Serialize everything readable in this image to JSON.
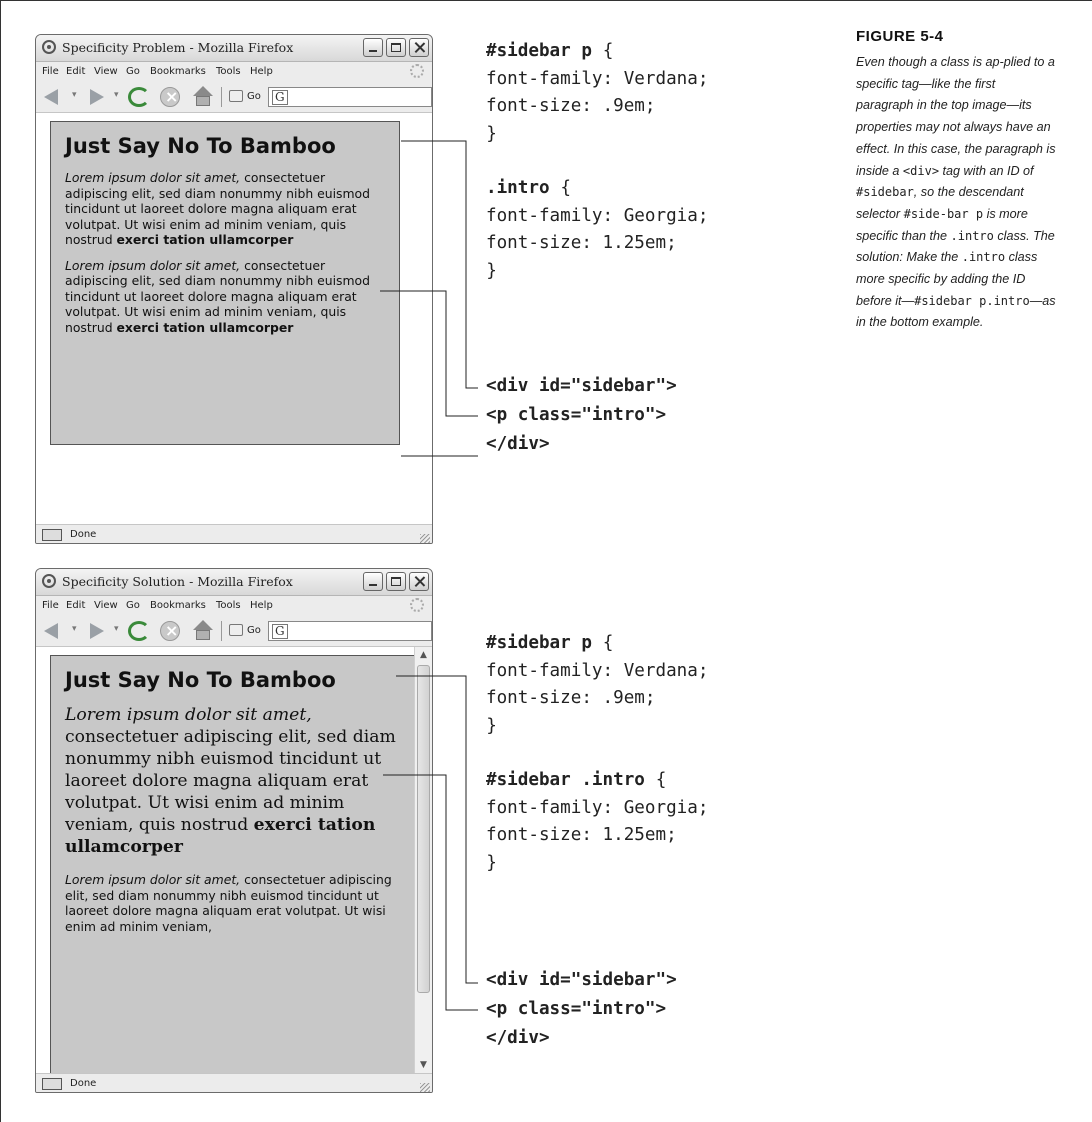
{
  "figure": {
    "label": "FIGURE 5-4",
    "caption": [
      {
        "t": "Even though a class is ap-plied to a specific tag—like the first paragraph in the top image—its properties may not always have an effect. In this case, the paragraph is inside a ",
        "m": false
      },
      {
        "t": "<div>",
        "m": true
      },
      {
        "t": " tag with an ID of ",
        "m": false
      },
      {
        "t": "#sidebar",
        "m": true
      },
      {
        "t": ", so the descendant selector ",
        "m": false
      },
      {
        "t": "#side-bar p",
        "m": true
      },
      {
        "t": " is more specific than the ",
        "m": false
      },
      {
        "t": ".intro",
        "m": true
      },
      {
        "t": " class. The solution: Make the ",
        "m": false
      },
      {
        "t": ".intro",
        "m": true
      },
      {
        "t": " class more specific by adding the ID before it—",
        "m": false
      },
      {
        "t": "#sidebar p.intro",
        "m": true
      },
      {
        "t": "—as in the bottom example.",
        "m": false
      }
    ]
  },
  "browser_top": {
    "title": "Specificity Problem - Mozilla Firefox",
    "menu": [
      "File",
      "Edit",
      "View",
      "Go",
      "Bookmarks",
      "Tools",
      "Help"
    ],
    "go_label": "Go",
    "url_icon_label": "G",
    "status": "Done",
    "heading": "Just Say No To Bamboo",
    "p1_italic": "Lorem ipsum dolor sit amet,",
    "p1_text": " consectetuer adipiscing elit, sed diam nonummy nibh euismod tincidunt ut laoreet dolore magna aliquam erat volutpat. Ut wisi enim ad minim veniam, quis nostrud ",
    "p1_bold": "exerci tation ullamcorper",
    "p2_italic": "Lorem ipsum dolor sit amet,",
    "p2_text": " consectetuer adipiscing elit, sed diam nonummy nibh euismod tincidunt ut laoreet dolore magna aliquam erat volutpat. Ut wisi enim ad minim veniam, quis nostrud ",
    "p2_bold": "exerci tation ullamcorper"
  },
  "browser_bottom": {
    "title": "Specificity Solution - Mozilla Firefox",
    "menu": [
      "File",
      "Edit",
      "View",
      "Go",
      "Bookmarks",
      "Tools",
      "Help"
    ],
    "go_label": "Go",
    "url_icon_label": "G",
    "status": "Done",
    "heading": "Just Say No To Bamboo",
    "p1_italic": "Lorem ipsum dolor sit amet,",
    "p1_text": " consectetuer adipiscing elit, sed diam nonummy nibh euismod tincidunt ut laoreet dolore magna aliquam erat volutpat. Ut wisi enim ad minim veniam, quis nostrud ",
    "p1_bold": "exerci tation ullamcorper",
    "p2_italic": "Lorem ipsum dolor sit amet,",
    "p2_text": " consectetuer adipiscing elit, sed diam nonummy nibh euismod tincidunt ut laoreet dolore magna aliquam erat volutpat. Ut wisi enim ad minim veniam,"
  },
  "code_top": {
    "css1_sel": "#sidebar p",
    "css1_l1": "font-family: Verdana;",
    "css1_l2": "font-size: .9em;",
    "css2_sel": ".intro",
    "css2_l1": "font-family: Georgia;",
    "css2_l2": "font-size: 1.25em;",
    "open_brace": "{",
    "close_brace": "}",
    "html1": "<div id=\"sidebar\">",
    "html2": "<p class=\"intro\">",
    "html3": "</div>"
  },
  "code_bottom": {
    "css1_sel": "#sidebar p",
    "css1_l1": "font-family: Verdana;",
    "css1_l2": "font-size: .9em;",
    "css2_sel": "#sidebar .intro",
    "css2_l1": "font-family: Georgia;",
    "css2_l2": "font-size: 1.25em;",
    "open_brace": "{",
    "close_brace": "}",
    "html1": "<div id=\"sidebar\">",
    "html2": "<p class=\"intro\">",
    "html3": "</div>"
  }
}
